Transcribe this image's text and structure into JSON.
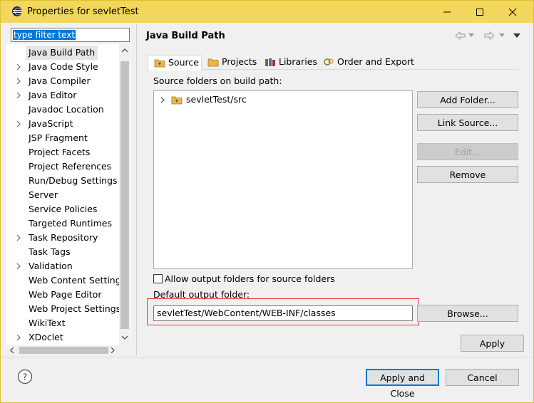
{
  "window": {
    "title": "Properties for sevletTest"
  },
  "filter": {
    "value": "type filter text"
  },
  "tree": {
    "items": [
      {
        "label": "Java Build Path",
        "expandable": false,
        "selected": true
      },
      {
        "label": "Java Code Style",
        "expandable": true
      },
      {
        "label": "Java Compiler",
        "expandable": true
      },
      {
        "label": "Java Editor",
        "expandable": true
      },
      {
        "label": "Javadoc Location",
        "expandable": false
      },
      {
        "label": "JavaScript",
        "expandable": true
      },
      {
        "label": "JSP Fragment",
        "expandable": false
      },
      {
        "label": "Project Facets",
        "expandable": false
      },
      {
        "label": "Project References",
        "expandable": false
      },
      {
        "label": "Run/Debug Settings",
        "expandable": false
      },
      {
        "label": "Server",
        "expandable": false
      },
      {
        "label": "Service Policies",
        "expandable": false
      },
      {
        "label": "Targeted Runtimes",
        "expandable": false
      },
      {
        "label": "Task Repository",
        "expandable": true
      },
      {
        "label": "Task Tags",
        "expandable": false
      },
      {
        "label": "Validation",
        "expandable": true
      },
      {
        "label": "Web Content Settings",
        "expandable": false
      },
      {
        "label": "Web Page Editor",
        "expandable": false
      },
      {
        "label": "Web Project Settings",
        "expandable": false
      },
      {
        "label": "WikiText",
        "expandable": false
      },
      {
        "label": "XDoclet",
        "expandable": true
      }
    ]
  },
  "page": {
    "title": "Java Build Path",
    "tabs": [
      {
        "label": "Source",
        "active": true,
        "icon": "source-folder-icon"
      },
      {
        "label": "Projects",
        "icon": "projects-icon"
      },
      {
        "label": "Libraries",
        "icon": "libraries-icon"
      },
      {
        "label": "Order and Export",
        "icon": "order-export-icon"
      }
    ],
    "source_label": "Source folders on build path:",
    "source_folders": [
      "sevletTest/src"
    ],
    "buttons": {
      "add_folder": "Add Folder...",
      "link_source": "Link Source...",
      "edit": "Edit...",
      "remove": "Remove",
      "browse": "Browse..."
    },
    "allow_output_label": "Allow output folders for source folders",
    "default_output_label": "Default output folder:",
    "default_output_value": "sevletTest/WebContent/WEB-INF/classes",
    "apply": "Apply"
  },
  "footer": {
    "apply_and_close": "Apply and Close",
    "cancel": "Cancel"
  },
  "colors": {
    "titlebar": "#f3d75c",
    "highlight": "#e03a3a",
    "accent": "#0078d7"
  }
}
